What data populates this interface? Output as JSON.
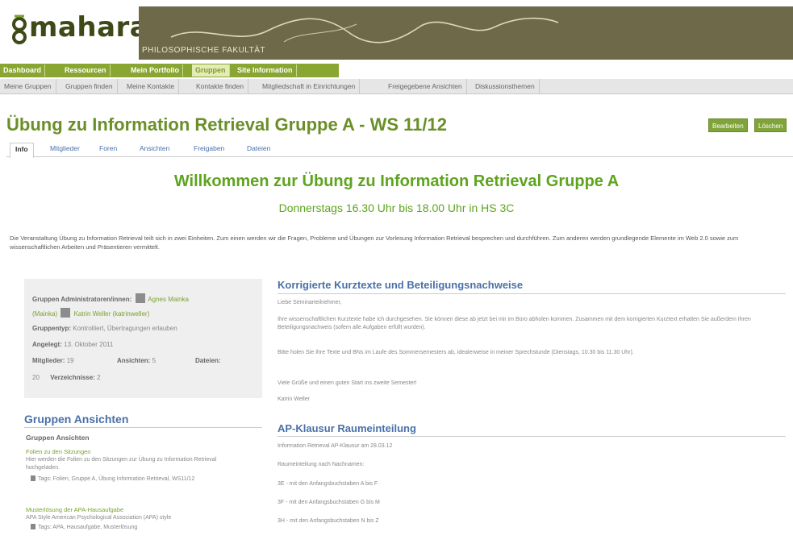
{
  "header": {
    "logo_text": "mahara",
    "banner_subtitle": "PHILOSOPHISCHE FAKULTÄT",
    "banner_color": "#6e6a49",
    "logo_color": "#3d4a17"
  },
  "main_nav": {
    "items": [
      {
        "label": "Dashboard",
        "active": false
      },
      {
        "label": "Ressourcen",
        "active": false
      },
      {
        "label": "Mein Portfolio",
        "active": false
      },
      {
        "label": "Gruppen",
        "active": true
      },
      {
        "label": "Site Information",
        "active": false
      }
    ],
    "accent": "#8aa632"
  },
  "sub_nav": {
    "items": [
      "Meine Gruppen",
      "Gruppen finden",
      "Meine Kontakte",
      "Kontakte finden",
      "Mitgliedschaft in Einrichtungen",
      "Freigegebene Ansichten",
      "Diskussionsthemen"
    ]
  },
  "page": {
    "title": "Übung zu Information Retrieval Gruppe A - WS 11/12",
    "edit_button": "Bearbeiten",
    "delete_button": "Löschen"
  },
  "tabs": [
    "Info",
    "Mitglieder",
    "Foren",
    "Ansichten",
    "Freigaben",
    "Dateien"
  ],
  "welcome": {
    "heading": "Willkommen zur Übung zu Information Retrieval Gruppe A",
    "subheading": "Donnerstags 16.30 Uhr bis 18.00 Uhr in HS 3C",
    "description": "Die Veranstaltung Übung zu Information Retrieval teilt sich in zwei Einheiten. Zum einen werden wir die Fragen, Probleme und Übungen zur Vorlesung Information Retrieval besprechen und durchführen. Zum anderen werden grundlegende Elemente im Web 2.0 sowie zum wissenschaftlichen Arbeiten und Präsentieren vermittelt."
  },
  "info": {
    "admins_label": "Gruppen Administratoren/innen:",
    "admin1": "Agnes Mainka",
    "admin1_user": "(Mainka)",
    "admin2": "Katrin Weller (katrinweller)",
    "type_label": "Gruppentyp:",
    "type_value": "Kontrolliert, Übertragungen erlauben",
    "created_label": "Angelegt:",
    "created_value": "13. Oktober 2011",
    "members_label": "Mitglieder:",
    "members_value": "19",
    "views_label": "Ansichten:",
    "views_value": "5",
    "files_label": "Dateien:",
    "files_value": "20",
    "folders_label": "Verzeichnisse:",
    "folders_value": "2"
  },
  "group_views": {
    "heading": "Gruppen Ansichten",
    "subheading": "Gruppen Ansichten",
    "items": [
      {
        "title": "Folien zu den Sitzungen",
        "description": "Hier werden die Folien zu den Sitzungen zur Übung zu Information Retrieval hochgeladen.",
        "tags": "Tags: Folien, Gruppe A, Übung Information Retrieval, WS11/12"
      },
      {
        "title": "Musterlösung der APA-Hausaufgabe",
        "description": "APA Style American Psychological Association (APA) style",
        "tags": "Tags: APA, Hausaufgabe, Musterlösung"
      }
    ]
  },
  "posts": [
    {
      "title": "Korrigierte Kurztexte und Beteiligungsnachweise",
      "paragraphs": [
        "Liebe Seminarteilnehmer,",
        "Ihre wissenschaftlichen Kurztexte habe ich durchgesehen. Sie können diese ab jetzt bei mir im Büro abholen kommen. Zusammen mit dem korrigierten Kurztext erhalten Sie außerdem Ihren Beteiligungsnachweis (sofern alle Aufgaben erfüllt wurden).",
        "Bitte holen Sie Ihre Texte und BNs im Laufe des Sommersemesters ab, idealerweise in meiner Sprechstunde (Dienstags, 10.30 bis 11.30 Uhr).",
        "Viele Grüße und einen guten Start ins zweite Semester!",
        "Katrin Weller"
      ]
    },
    {
      "title": "AP-Klausur Raumeinteilung",
      "paragraphs": [
        "Information Retrieval AP-Klausur am 28.03.12",
        "Raumeinteilung nach Nachnamen:",
        "3E - mit den Anfangsbuchstaben A bis F",
        "3F - mit den Anfangsbuchstaben G bis M",
        "3H - mit den Anfangsbuchstaben N bis Z"
      ]
    }
  ]
}
